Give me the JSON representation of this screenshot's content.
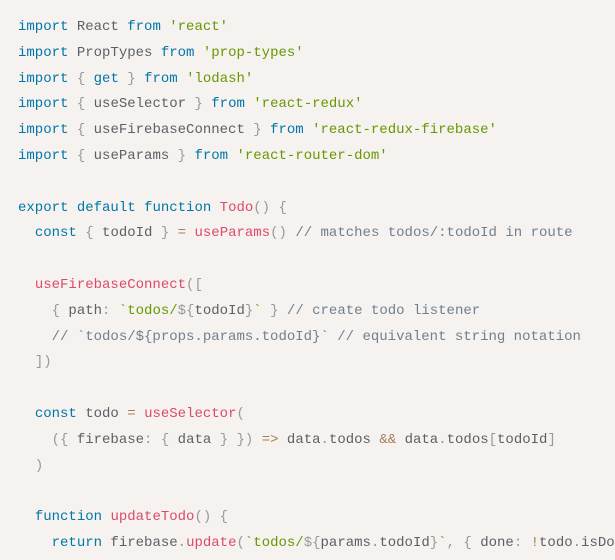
{
  "code": {
    "tokens": [
      [
        [
          "keyword",
          "import"
        ],
        [
          "plain",
          " React "
        ],
        [
          "keyword",
          "from"
        ],
        [
          "plain",
          " "
        ],
        [
          "string",
          "'react'"
        ]
      ],
      [
        [
          "keyword",
          "import"
        ],
        [
          "plain",
          " PropTypes "
        ],
        [
          "keyword",
          "from"
        ],
        [
          "plain",
          " "
        ],
        [
          "string",
          "'prop-types'"
        ]
      ],
      [
        [
          "keyword",
          "import"
        ],
        [
          "plain",
          " "
        ],
        [
          "punct",
          "{"
        ],
        [
          "plain",
          " "
        ],
        [
          "keyword",
          "get"
        ],
        [
          "plain",
          " "
        ],
        [
          "punct",
          "}"
        ],
        [
          "plain",
          " "
        ],
        [
          "keyword",
          "from"
        ],
        [
          "plain",
          " "
        ],
        [
          "string",
          "'lodash'"
        ]
      ],
      [
        [
          "keyword",
          "import"
        ],
        [
          "plain",
          " "
        ],
        [
          "punct",
          "{"
        ],
        [
          "plain",
          " useSelector "
        ],
        [
          "punct",
          "}"
        ],
        [
          "plain",
          " "
        ],
        [
          "keyword",
          "from"
        ],
        [
          "plain",
          " "
        ],
        [
          "string",
          "'react-redux'"
        ]
      ],
      [
        [
          "keyword",
          "import"
        ],
        [
          "plain",
          " "
        ],
        [
          "punct",
          "{"
        ],
        [
          "plain",
          " useFirebaseConnect "
        ],
        [
          "punct",
          "}"
        ],
        [
          "plain",
          " "
        ],
        [
          "keyword",
          "from"
        ],
        [
          "plain",
          " "
        ],
        [
          "string",
          "'react-redux-firebase'"
        ]
      ],
      [
        [
          "keyword",
          "import"
        ],
        [
          "plain",
          " "
        ],
        [
          "punct",
          "{"
        ],
        [
          "plain",
          " useParams "
        ],
        [
          "punct",
          "}"
        ],
        [
          "plain",
          " "
        ],
        [
          "keyword",
          "from"
        ],
        [
          "plain",
          " "
        ],
        [
          "string",
          "'react-router-dom'"
        ]
      ],
      [],
      [
        [
          "keyword",
          "export"
        ],
        [
          "plain",
          " "
        ],
        [
          "keyword",
          "default"
        ],
        [
          "plain",
          " "
        ],
        [
          "keyword",
          "function"
        ],
        [
          "plain",
          " "
        ],
        [
          "classname",
          "Todo"
        ],
        [
          "punct",
          "()"
        ],
        [
          "plain",
          " "
        ],
        [
          "punct",
          "{"
        ]
      ],
      [
        [
          "plain",
          "  "
        ],
        [
          "keyword",
          "const"
        ],
        [
          "plain",
          " "
        ],
        [
          "punct",
          "{"
        ],
        [
          "plain",
          " todoId "
        ],
        [
          "punct",
          "}"
        ],
        [
          "plain",
          " "
        ],
        [
          "operator",
          "="
        ],
        [
          "plain",
          " "
        ],
        [
          "func",
          "useParams"
        ],
        [
          "punct",
          "()"
        ],
        [
          "plain",
          " "
        ],
        [
          "comment",
          "// matches todos/:todoId in route"
        ]
      ],
      [],
      [
        [
          "plain",
          "  "
        ],
        [
          "func",
          "useFirebaseConnect"
        ],
        [
          "punct",
          "(["
        ]
      ],
      [
        [
          "plain",
          "    "
        ],
        [
          "punct",
          "{"
        ],
        [
          "plain",
          " path"
        ],
        [
          "punct",
          ":"
        ],
        [
          "plain",
          " "
        ],
        [
          "string",
          "`todos/"
        ],
        [
          "punct",
          "${"
        ],
        [
          "plain",
          "todoId"
        ],
        [
          "punct",
          "}"
        ],
        [
          "string",
          "`"
        ],
        [
          "plain",
          " "
        ],
        [
          "punct",
          "}"
        ],
        [
          "plain",
          " "
        ],
        [
          "comment",
          "// create todo listener"
        ]
      ],
      [
        [
          "plain",
          "    "
        ],
        [
          "comment",
          "// `todos/${props.params.todoId}` // equivalent string notation"
        ]
      ],
      [
        [
          "plain",
          "  "
        ],
        [
          "punct",
          "])"
        ]
      ],
      [],
      [
        [
          "plain",
          "  "
        ],
        [
          "keyword",
          "const"
        ],
        [
          "plain",
          " todo "
        ],
        [
          "operator",
          "="
        ],
        [
          "plain",
          " "
        ],
        [
          "func",
          "useSelector"
        ],
        [
          "punct",
          "("
        ]
      ],
      [
        [
          "plain",
          "    "
        ],
        [
          "punct",
          "({"
        ],
        [
          "plain",
          " firebase"
        ],
        [
          "punct",
          ":"
        ],
        [
          "plain",
          " "
        ],
        [
          "punct",
          "{"
        ],
        [
          "plain",
          " data "
        ],
        [
          "punct",
          "}"
        ],
        [
          "plain",
          " "
        ],
        [
          "punct",
          "})"
        ],
        [
          "plain",
          " "
        ],
        [
          "operator",
          "=>"
        ],
        [
          "plain",
          " data"
        ],
        [
          "punct",
          "."
        ],
        [
          "plain",
          "todos "
        ],
        [
          "operator",
          "&&"
        ],
        [
          "plain",
          " data"
        ],
        [
          "punct",
          "."
        ],
        [
          "plain",
          "todos"
        ],
        [
          "punct",
          "["
        ],
        [
          "plain",
          "todoId"
        ],
        [
          "punct",
          "]"
        ]
      ],
      [
        [
          "plain",
          "  "
        ],
        [
          "punct",
          ")"
        ]
      ],
      [],
      [
        [
          "plain",
          "  "
        ],
        [
          "keyword",
          "function"
        ],
        [
          "plain",
          " "
        ],
        [
          "func",
          "updateTodo"
        ],
        [
          "punct",
          "()"
        ],
        [
          "plain",
          " "
        ],
        [
          "punct",
          "{"
        ]
      ],
      [
        [
          "plain",
          "    "
        ],
        [
          "keyword",
          "return"
        ],
        [
          "plain",
          " firebase"
        ],
        [
          "punct",
          "."
        ],
        [
          "func",
          "update"
        ],
        [
          "punct",
          "("
        ],
        [
          "string",
          "`todos/"
        ],
        [
          "punct",
          "${"
        ],
        [
          "plain",
          "params"
        ],
        [
          "punct",
          "."
        ],
        [
          "plain",
          "todoId"
        ],
        [
          "punct",
          "}"
        ],
        [
          "string",
          "`"
        ],
        [
          "punct",
          ","
        ],
        [
          "plain",
          " "
        ],
        [
          "punct",
          "{"
        ],
        [
          "plain",
          " done"
        ],
        [
          "punct",
          ":"
        ],
        [
          "plain",
          " "
        ],
        [
          "operator",
          "!"
        ],
        [
          "plain",
          "todo"
        ],
        [
          "punct",
          "."
        ],
        [
          "plain",
          "isDone "
        ],
        [
          "punct",
          "})"
        ]
      ],
      [
        [
          "plain",
          "  "
        ],
        [
          "punct",
          "}"
        ]
      ]
    ]
  }
}
